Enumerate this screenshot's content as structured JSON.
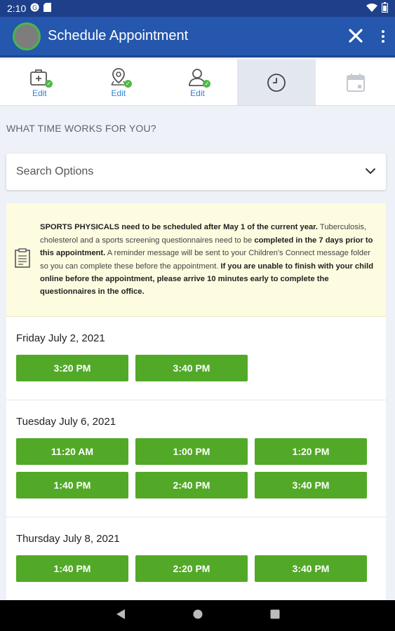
{
  "status_bar": {
    "time": "2:10"
  },
  "app_bar": {
    "title": "Schedule Appointment"
  },
  "steps": [
    {
      "name": "clinic-step",
      "icon": "medical-bag-icon",
      "label": "Edit",
      "complete": true
    },
    {
      "name": "location-step",
      "icon": "map-pin-icon",
      "label": "Edit",
      "complete": true
    },
    {
      "name": "provider-step",
      "icon": "person-icon",
      "label": "Edit",
      "complete": true
    },
    {
      "name": "time-step",
      "icon": "clock-icon",
      "label": "",
      "active": true
    },
    {
      "name": "date-step",
      "icon": "calendar-icon",
      "label": ""
    }
  ],
  "section_heading": "WHAT TIME WORKS FOR YOU?",
  "search": {
    "label": "Search Options"
  },
  "notice": {
    "bold1": "SPORTS PHYSICALS need to be scheduled after May 1 of the current year.",
    "text1": " Tuberculosis, cholesterol and a sports screening questionnaires need to be ",
    "bold2": "completed in the 7 days prior to this appointment.",
    "text2": " A reminder message will be sent to your Children's Connect message folder so you can complete these before the appointment. ",
    "bold3": "If you are unable to finish with your child online before the appointment, please arrive 10 minutes early to complete the questionnaires in the office."
  },
  "days": [
    {
      "date": "Friday July 2, 2021",
      "slots": [
        "3:20 PM",
        "3:40 PM"
      ]
    },
    {
      "date": "Tuesday July 6, 2021",
      "slots": [
        "11:20 AM",
        "1:00 PM",
        "1:20 PM",
        "1:40 PM",
        "2:40 PM",
        "3:40 PM"
      ]
    },
    {
      "date": "Thursday July 8, 2021",
      "slots": [
        "1:40 PM",
        "2:20 PM",
        "3:40 PM"
      ]
    }
  ],
  "colors": {
    "primary": "#2457ad",
    "slot": "#52a928",
    "notice_bg": "#fdfbe0",
    "check": "#4fba48"
  }
}
